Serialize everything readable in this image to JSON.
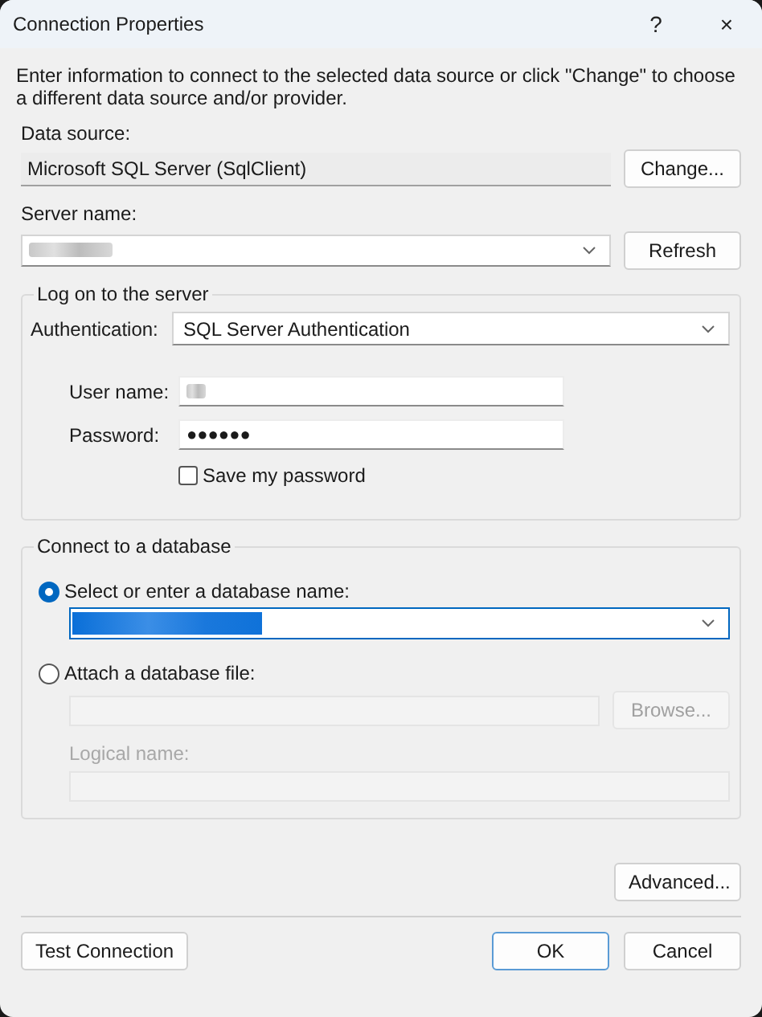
{
  "window": {
    "title": "Connection Properties",
    "help_button": "?",
    "close_button": "×"
  },
  "description": "Enter information to connect to the selected data source or click \"Change\" to choose a different data source and/or provider.",
  "data_source": {
    "label": "Data source:",
    "value": "Microsoft SQL Server (SqlClient)",
    "button": "Change..."
  },
  "server_name": {
    "label": "Server name:",
    "redacted": true,
    "button": "Refresh"
  },
  "log_on": {
    "title": "Log on to the server",
    "authentication": {
      "label": "Authentication:",
      "value": "SQL Server Authentication"
    },
    "user_name": {
      "label": "User name:",
      "redacted": true
    },
    "password": {
      "label": "Password:",
      "value": "●●●●●●"
    },
    "save_password": {
      "label": "Save my password",
      "checked": false
    }
  },
  "database": {
    "title": "Connect to a database",
    "options": [
      {
        "label": "Select or enter a database name:",
        "selected": true
      },
      {
        "label": "Attach a database file:",
        "selected": false
      }
    ],
    "database_name": {
      "redacted": true,
      "highlighted": true
    },
    "file": {
      "button": "Browse...",
      "disabled": true
    },
    "logical_name": {
      "label": "Logical name:",
      "disabled": true
    }
  },
  "advanced_button": "Advanced...",
  "buttons": [
    {
      "label": "Test Connection",
      "default": false
    },
    {
      "label": "OK",
      "default": true
    },
    {
      "label": "Cancel",
      "default": false
    }
  ]
}
